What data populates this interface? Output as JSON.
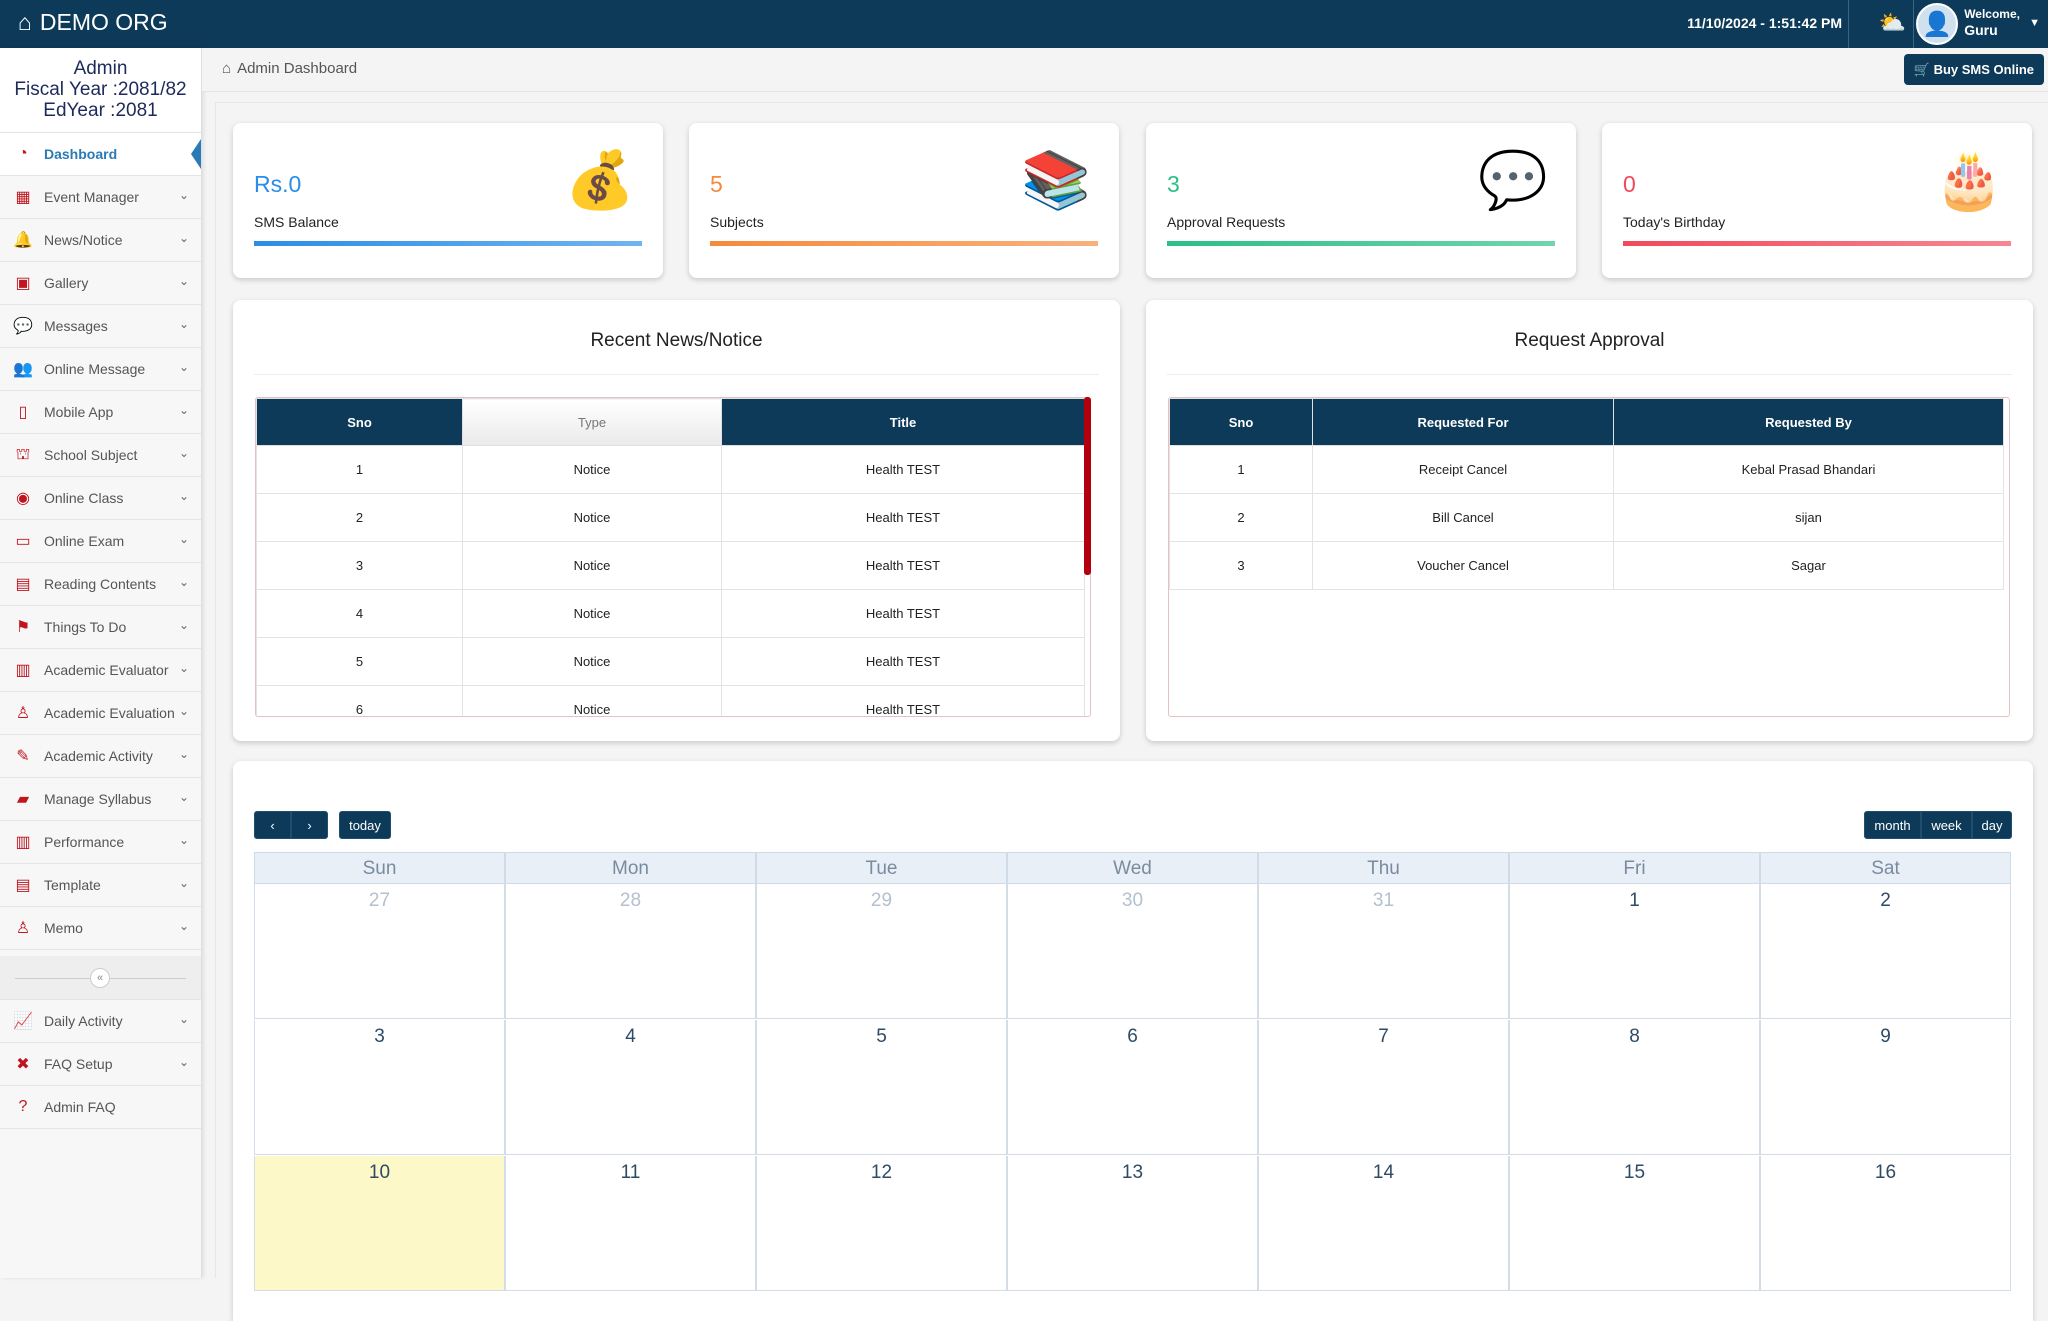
{
  "topbar": {
    "brand": "DEMO ORG",
    "datetime": "11/10/2024 - 1:51:42 PM",
    "welcome": "Welcome,",
    "user": "Guru"
  },
  "sidebar": {
    "role": "Admin",
    "fiscal_year": "Fiscal Year :2081/82",
    "ed_year": "EdYear :2081",
    "items": [
      {
        "label": "Dashboard",
        "icon": "dashboard-icon",
        "glyph": "◔"
      },
      {
        "label": "Event Manager",
        "icon": "calendar-icon",
        "glyph": "▦"
      },
      {
        "label": "News/Notice",
        "icon": "bell-icon",
        "glyph": "🔔"
      },
      {
        "label": "Gallery",
        "icon": "image-icon",
        "glyph": "▣"
      },
      {
        "label": "Messages",
        "icon": "chat-icon",
        "glyph": "💬"
      },
      {
        "label": "Online Message",
        "icon": "users-icon",
        "glyph": "👥"
      },
      {
        "label": "Mobile App",
        "icon": "mobile-icon",
        "glyph": "▯"
      },
      {
        "label": "School Subject",
        "icon": "subject-icon",
        "glyph": "⛫"
      },
      {
        "label": "Online Class",
        "icon": "class-icon",
        "glyph": "◉"
      },
      {
        "label": "Online Exam",
        "icon": "exam-icon",
        "glyph": "▭"
      },
      {
        "label": "Reading Contents",
        "icon": "book-icon",
        "glyph": "▤"
      },
      {
        "label": "Things To Do",
        "icon": "flag-icon",
        "glyph": "⚑"
      },
      {
        "label": "Academic Evaluator",
        "icon": "bar-chart-icon",
        "glyph": "▥"
      },
      {
        "label": "Academic Evaluation",
        "icon": "person-pin-icon",
        "glyph": "♙"
      },
      {
        "label": "Academic Activity",
        "icon": "edit-icon",
        "glyph": "✎"
      },
      {
        "label": "Manage Syllabus",
        "icon": "syllabus-icon",
        "glyph": "▰"
      },
      {
        "label": "Performance",
        "icon": "bar-chart-icon",
        "glyph": "▥"
      },
      {
        "label": "Template",
        "icon": "template-icon",
        "glyph": "▤"
      },
      {
        "label": "Memo",
        "icon": "memo-icon",
        "glyph": "♙"
      }
    ],
    "bottom_items": [
      {
        "label": "Daily Activity",
        "icon": "line-chart-icon",
        "glyph": "📈"
      },
      {
        "label": "FAQ Setup",
        "icon": "tools-icon",
        "glyph": "✖"
      },
      {
        "label": "Admin FAQ",
        "icon": "question-icon",
        "glyph": "?"
      }
    ]
  },
  "breadcrumb": {
    "label": "Admin Dashboard",
    "buy_sms": "Buy SMS Online"
  },
  "stats": [
    {
      "value": "Rs.0",
      "label": "SMS Balance",
      "color": "#2a8ee6",
      "emoji": "💰"
    },
    {
      "value": "5",
      "label": "Subjects",
      "color": "#f58a3c",
      "emoji": "📚"
    },
    {
      "value": "3",
      "label": "Approval Requests",
      "color": "#2bbf86",
      "emoji": "💬"
    },
    {
      "value": "0",
      "label": "Today's Birthday",
      "color": "#f2495c",
      "emoji": "🎂"
    }
  ],
  "news": {
    "title": "Recent News/Notice",
    "columns": [
      "Sno",
      "Type",
      "Title"
    ],
    "rows": [
      [
        "1",
        "Notice",
        "Health TEST"
      ],
      [
        "2",
        "Notice",
        "Health TEST"
      ],
      [
        "3",
        "Notice",
        "Health TEST"
      ],
      [
        "4",
        "Notice",
        "Health TEST"
      ],
      [
        "5",
        "Notice",
        "Health TEST"
      ],
      [
        "6",
        "Notice",
        "Health TEST"
      ]
    ]
  },
  "approval": {
    "title": "Request Approval",
    "columns": [
      "Sno",
      "Requested For",
      "Requested By"
    ],
    "rows": [
      [
        "1",
        "Receipt Cancel",
        "Kebal Prasad Bhandari"
      ],
      [
        "2",
        "Bill Cancel",
        "sijan"
      ],
      [
        "3",
        "Voucher Cancel",
        "Sagar"
      ]
    ]
  },
  "calendar": {
    "today_label": "today",
    "views": [
      "month",
      "week",
      "day"
    ],
    "days": [
      "Sun",
      "Mon",
      "Tue",
      "Wed",
      "Thu",
      "Fri",
      "Sat"
    ],
    "weeks": [
      [
        "27",
        "28",
        "29",
        "30",
        "31",
        "1",
        "2"
      ],
      [
        "3",
        "4",
        "5",
        "6",
        "7",
        "8",
        "9"
      ],
      [
        "10",
        "11",
        "12",
        "13",
        "14",
        "15",
        "16"
      ]
    ],
    "other_month": [
      "27",
      "28",
      "29",
      "30",
      "31"
    ],
    "today": "10"
  }
}
